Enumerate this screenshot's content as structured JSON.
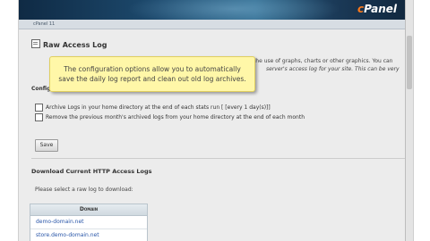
{
  "header": {
    "brand_c": "c",
    "brand_rest": "Panel",
    "breadcrumb": "cPanel 11"
  },
  "page": {
    "title": "Raw Access Log",
    "desc_line1": "at the use of graphs, charts or other graphics. You can",
    "desc_line2": "server's access log for your site. This can be very"
  },
  "tooltip": {
    "line1": "The configuration options allow you to automatically",
    "line2": "save the daily log report and clean out old log archives."
  },
  "config": {
    "label": "Configure Logs",
    "option1": "Archive Logs in your home directory at the end of each stats run [ [every 1 day(s)]]",
    "option2": "Remove the previous month's archived logs from your home directory at the end of each month",
    "save_label": "Save"
  },
  "download": {
    "title": "Download Current HTTP Access Logs",
    "instruction": "Please select a raw log to download:",
    "table_header": "Domain",
    "rows": [
      "demo-domain.net",
      "store.demo-domain.net"
    ]
  }
}
